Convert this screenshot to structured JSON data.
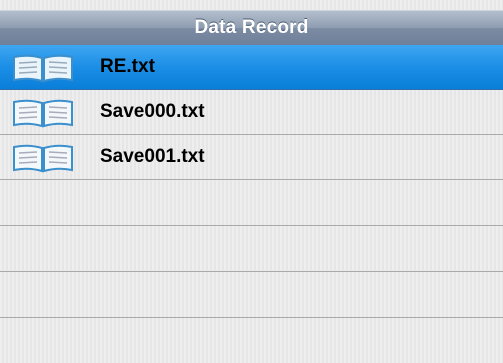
{
  "title": "Data Record",
  "files": [
    {
      "name": "RE.txt",
      "selected": true,
      "icon": "book-icon"
    },
    {
      "name": "Save000.txt",
      "selected": false,
      "icon": "book-icon"
    },
    {
      "name": "Save001.txt",
      "selected": false,
      "icon": "book-icon"
    }
  ],
  "colors": {
    "selected": "#1b8ee6",
    "titlebar": "#7b8ba2",
    "icon_cover": "#4a9fd6"
  }
}
